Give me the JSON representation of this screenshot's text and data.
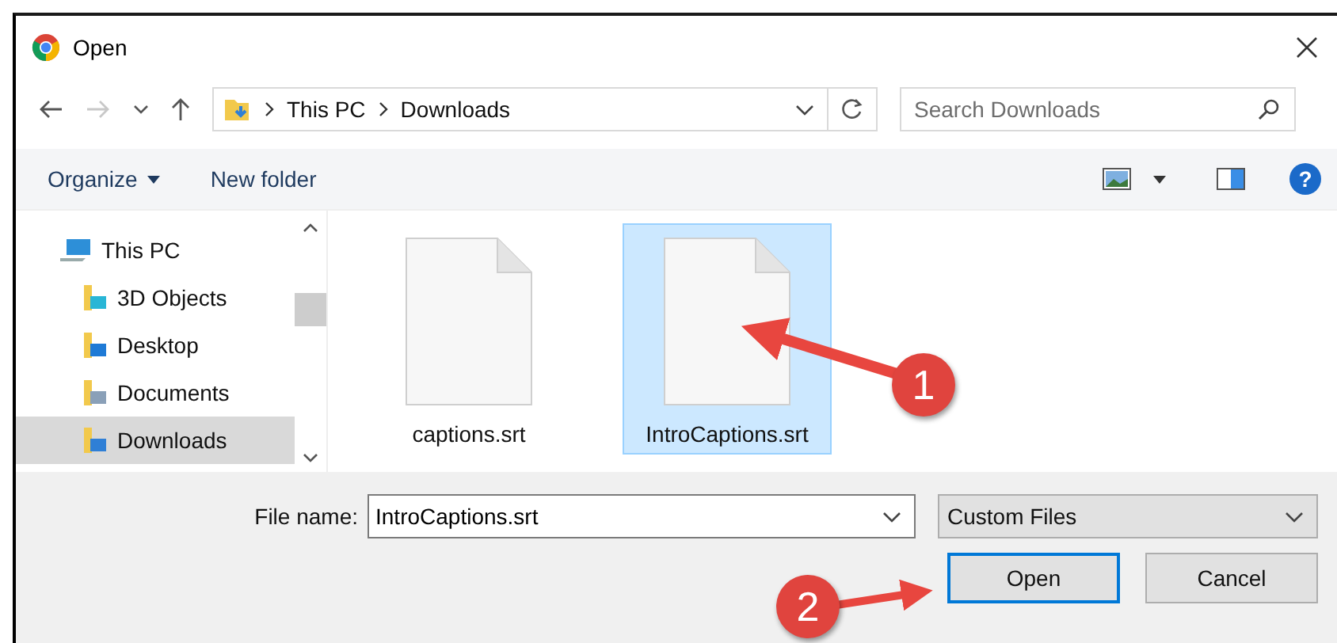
{
  "window": {
    "title": "Open"
  },
  "address_bar": {
    "path": [
      "This PC",
      "Downloads"
    ],
    "search_placeholder": "Search Downloads"
  },
  "toolbar": {
    "organize": "Organize",
    "new_folder": "New folder",
    "help": "?"
  },
  "sidebar": {
    "items": [
      {
        "label": "This PC",
        "selected": false,
        "children": [
          {
            "label": "3D Objects",
            "kind": "objects",
            "selected": false
          },
          {
            "label": "Desktop",
            "kind": "desktop",
            "selected": false
          },
          {
            "label": "Documents",
            "kind": "documents",
            "selected": false
          },
          {
            "label": "Downloads",
            "kind": "downloads",
            "selected": true
          }
        ]
      }
    ]
  },
  "files": [
    {
      "name": "captions.srt",
      "selected": false
    },
    {
      "name": "IntroCaptions.srt",
      "selected": true
    }
  ],
  "file_name": {
    "label": "File name:",
    "value": "IntroCaptions.srt"
  },
  "file_type": "Custom Files",
  "buttons": [
    {
      "label": "Open",
      "default": true
    },
    {
      "label": "Cancel",
      "default": false
    }
  ],
  "annotations": [
    {
      "number": "1"
    },
    {
      "number": "2"
    }
  ]
}
